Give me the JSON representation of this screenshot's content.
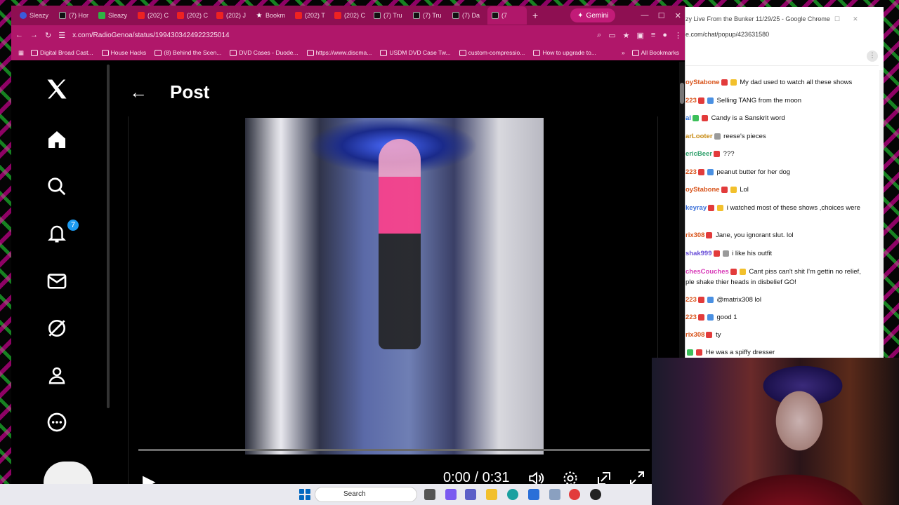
{
  "browser": {
    "tabs": [
      {
        "label": "Sleazy",
        "icon": "r"
      },
      {
        "label": "(7) Hor",
        "icon": "x"
      },
      {
        "label": "Sleazy",
        "icon": "g"
      },
      {
        "label": "(202) C",
        "icon": "yt"
      },
      {
        "label": "(202) C",
        "icon": "yt"
      },
      {
        "label": "(202) J",
        "icon": "yt"
      },
      {
        "label": "Bookm",
        "icon": "star"
      },
      {
        "label": "(202) T",
        "icon": "yt"
      },
      {
        "label": "(202) C",
        "icon": "yt"
      },
      {
        "label": "(7) Tru",
        "icon": "x"
      },
      {
        "label": "(7) Tru",
        "icon": "x"
      },
      {
        "label": "(7) Da",
        "icon": "x"
      },
      {
        "label": "(7",
        "icon": "x"
      }
    ],
    "new_tab": "+",
    "gemini": "Gemini",
    "url": "x.com/RadioGenoa/status/1994303424922325014",
    "bookmarks": [
      "Digital Broad Cast...",
      "House Hacks",
      "(8) Behind the Scen...",
      "DVD Cases - Duode...",
      "https://www.discma...",
      "USDM DVD Case Tw...",
      "custom-compressio...",
      "How to upgrade to..."
    ],
    "all_bookmarks": "All Bookmarks"
  },
  "x": {
    "back": "←",
    "title": "Post",
    "notif_count": "7",
    "icons": [
      "x-logo-icon",
      "home-icon",
      "search-icon",
      "bell-icon",
      "mail-icon",
      "grok-icon",
      "profile-icon",
      "more-icon"
    ]
  },
  "video": {
    "time": "0:00 / 0:31",
    "progress": 0
  },
  "chat": {
    "window_title": "zy Live From the Bunker 11/29/25 - Google Chrome",
    "url": "e.com/chat/popup/423631580",
    "messages": [
      {
        "user": "oyStabone",
        "color": "#d8531a",
        "badges": [
          "red",
          "yel"
        ],
        "text": "My dad used to watch all these shows"
      },
      {
        "user": "223",
        "color": "#d8531a",
        "badges": [
          "red",
          "blu"
        ],
        "text": "Selling TANG from the moon"
      },
      {
        "user": "al",
        "color": "#2a6fd8",
        "badges": [
          "grn",
          "red"
        ],
        "text": "Candy is a Sanskrit word"
      },
      {
        "user": "arLooter",
        "color": "#c78a12",
        "badges": [
          "gry"
        ],
        "text": "reese's pieces"
      },
      {
        "user": "ericBeer",
        "color": "#2fa06b",
        "badges": [
          "red"
        ],
        "text": "???"
      },
      {
        "user": "223",
        "color": "#d8531a",
        "badges": [
          "red",
          "blu"
        ],
        "text": "peanut butter for her dog"
      },
      {
        "user": "oyStabone",
        "color": "#d8531a",
        "badges": [
          "red",
          "yel"
        ],
        "text": "Lol"
      },
      {
        "user": "keyray",
        "color": "#3a6fd8",
        "badges": [
          "red",
          "yel"
        ],
        "text": "i watched most of these shows ,choices were"
      },
      {
        "user": "rix308",
        "color": "#d8531a",
        "badges": [
          "red"
        ],
        "text": "Jane, you ignorant slut. lol"
      },
      {
        "user": "shak999",
        "color": "#6a4fd8",
        "badges": [
          "red",
          "gry"
        ],
        "text": "i like his outfit"
      },
      {
        "user": "chesCouches",
        "color": "#d83ab8",
        "badges": [
          "red",
          "yel"
        ],
        "text": "Cant piss can't shit I'm gettin no relief,"
      },
      {
        "user": "",
        "color": "#111",
        "badges": [],
        "text": "ple shake thier heads in disbelief GO!"
      },
      {
        "user": "223",
        "color": "#d8531a",
        "badges": [
          "red",
          "blu"
        ],
        "text": "@matrix308 lol"
      },
      {
        "user": "223",
        "color": "#d8531a",
        "badges": [
          "red",
          "blu"
        ],
        "text": "good 1"
      },
      {
        "user": "rix308",
        "color": "#d8531a",
        "badges": [
          "red"
        ],
        "text": "ty"
      },
      {
        "user": "",
        "color": "#d8531a",
        "badges": [
          "grn",
          "red"
        ],
        "text": "He was a spiffy dresser"
      }
    ]
  },
  "taskbar": {
    "search": "Search"
  }
}
